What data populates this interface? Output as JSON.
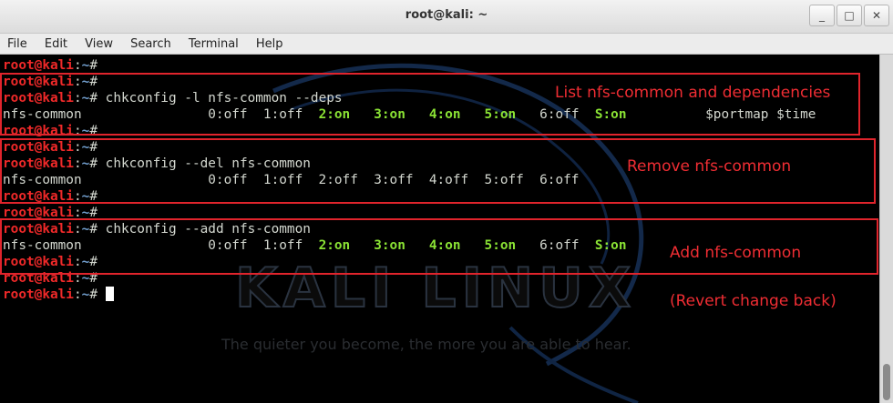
{
  "window": {
    "title": "root@kali: ~",
    "buttons": [
      "_",
      "□",
      "✕"
    ]
  },
  "menu": [
    "File",
    "Edit",
    "View",
    "Search",
    "Terminal",
    "Help"
  ],
  "prompt": {
    "user": "root@kali",
    "sep": ":",
    "path": "~",
    "sym": "# "
  },
  "lines": [
    {
      "type": "prompt",
      "cmd": ""
    },
    {
      "type": "prompt",
      "cmd": ""
    },
    {
      "type": "prompt",
      "cmd": "chkconfig -l nfs-common --deps"
    },
    {
      "type": "out",
      "text": "nfs-common                0:off  1:off  2:on   3:on   4:on   5:on   6:off  S:on          $portmap $time"
    },
    {
      "type": "prompt",
      "cmd": ""
    },
    {
      "type": "prompt",
      "cmd": ""
    },
    {
      "type": "prompt",
      "cmd": "chkconfig --del nfs-common"
    },
    {
      "type": "out",
      "text": "nfs-common                0:off  1:off  2:off  3:off  4:off  5:off  6:off"
    },
    {
      "type": "prompt",
      "cmd": ""
    },
    {
      "type": "prompt",
      "cmd": ""
    },
    {
      "type": "prompt",
      "cmd": "chkconfig --add nfs-common"
    },
    {
      "type": "out",
      "text": "nfs-common                0:off  1:off  2:on   3:on   4:on   5:on   6:off  S:on"
    },
    {
      "type": "prompt",
      "cmd": ""
    },
    {
      "type": "prompt",
      "cmd": ""
    },
    {
      "type": "prompt",
      "cmd": "",
      "cursor": true
    }
  ],
  "annotations": {
    "list": "List nfs-common and dependencies",
    "remove": "Remove nfs-common",
    "add": "Add nfs-common",
    "revert": "(Revert change back)"
  },
  "wallpaper": {
    "logo": "KALI LINUX",
    "tagline": "The quieter you become, the more you are able to hear."
  },
  "colors": {
    "user": "#ef2929",
    "path": "#729fcf",
    "on": "#8ae234",
    "text": "#d3d7cf",
    "annotation": "#e0242c"
  }
}
